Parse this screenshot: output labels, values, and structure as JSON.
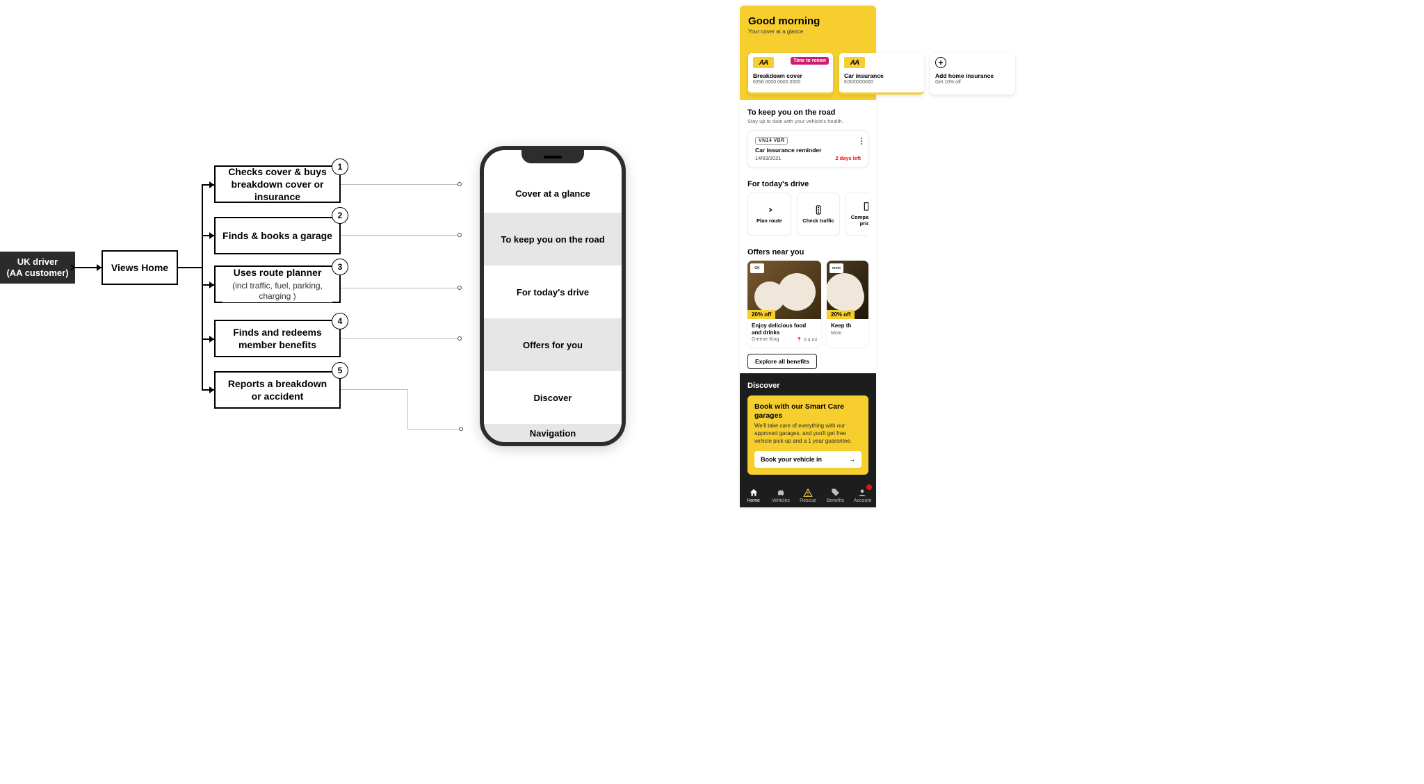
{
  "diagram": {
    "actor": "UK driver\n(AA customer)",
    "home": "Views Home",
    "tasks": [
      {
        "n": "1",
        "label": "Checks cover & buys breakdown cover or insurance"
      },
      {
        "n": "2",
        "label": "Finds & books a garage"
      },
      {
        "n": "3",
        "label": "Uses route planner",
        "sub": "(incl traffic, fuel, parking, charging )"
      },
      {
        "n": "4",
        "label": "Finds and redeems member benefits"
      },
      {
        "n": "5",
        "label": "Reports a breakdown or accident"
      }
    ],
    "wireframe_sections": [
      "Cover at a glance",
      "To keep you on the road",
      "For today's drive",
      "Offers for you",
      "Discover",
      "Navigation"
    ]
  },
  "app": {
    "greeting": "Good morning",
    "greeting_sub": "Your cover at a glance",
    "cover_cards": [
      {
        "logo": "AA",
        "badge": "Time to renew",
        "title": "Breakdown cover",
        "number": "6356 0000 0000 0000"
      },
      {
        "logo": "AA",
        "title": "Car insurance",
        "number": "K00/0000000"
      },
      {
        "icon": "plus",
        "title": "Add home insurance",
        "number": "Get 10% off"
      }
    ],
    "road": {
      "title": "To keep you on the road",
      "hint": "Stay up to date with your vehicle's health.",
      "reminder": {
        "reg": "VN14 VBR",
        "title": "Car insurance reminder",
        "date": "14/03/2021",
        "left": "2 days left"
      }
    },
    "drive": {
      "title": "For today's drive",
      "tiles": [
        {
          "icon": "route",
          "label": "Plan route"
        },
        {
          "icon": "traffic",
          "label": "Check traffic"
        },
        {
          "icon": "fuel",
          "label": "Compare fuel prices"
        }
      ]
    },
    "offers": {
      "title": "Offers near you",
      "items": [
        {
          "brand": "GK",
          "tag": "20% off",
          "caption": "Enjoy delicious food and drinks",
          "merchant": "Greene King",
          "distance": "0.4 mi"
        },
        {
          "brand": "moto",
          "tag": "20% off",
          "caption": "Keep th",
          "merchant": "Moto",
          "distance": ""
        }
      ],
      "explore": "Explore all benefits"
    },
    "discover": {
      "title": "Discover",
      "card_title": "Book with our Smart Care garages",
      "card_body": "We'll take care of everything with our approved garages, and you'll get free vehicle pick-up and a 1 year guarantee.",
      "cta": "Book your vehicle in"
    },
    "tabs": [
      {
        "icon": "home",
        "label": "Home",
        "active": true
      },
      {
        "icon": "car",
        "label": "Vehicles"
      },
      {
        "icon": "warn",
        "label": "Rescue"
      },
      {
        "icon": "tag",
        "label": "Benefits"
      },
      {
        "icon": "user",
        "label": "Account"
      }
    ]
  }
}
